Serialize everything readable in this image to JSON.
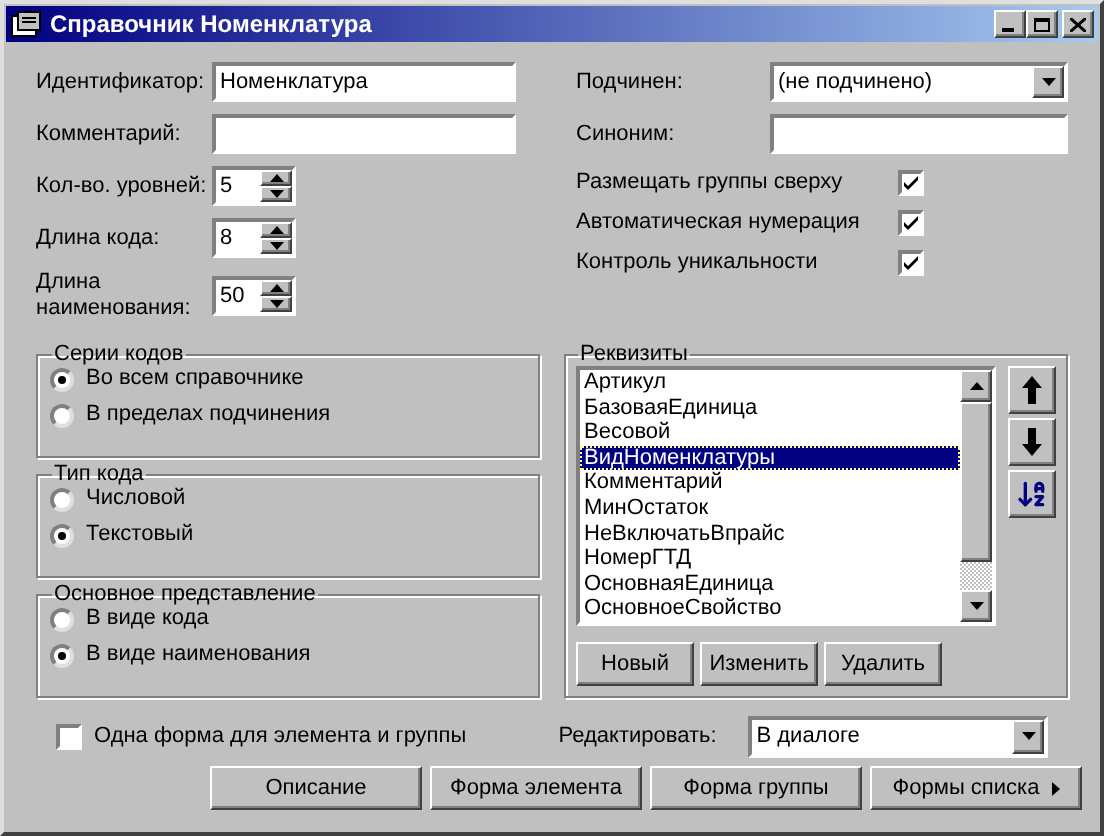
{
  "window": {
    "title": "Справочник Номенклатура"
  },
  "left_fields": [
    {
      "kind": "text",
      "label": "Идентификатор:",
      "value": "Номенклатура"
    },
    {
      "kind": "text",
      "label": "Комментарий:"
    },
    {
      "kind": "spin",
      "label": "Кол-во. уровней:",
      "value": "5"
    },
    {
      "kind": "spin",
      "label": "Длина кода:",
      "value": "8"
    },
    {
      "kind": "spin",
      "label": "Длина наименования:",
      "value": "50"
    }
  ],
  "right_fields": [
    {
      "kind": "select",
      "label": "Подчинен:",
      "value": "(не подчинено)"
    },
    {
      "kind": "text",
      "label": "Синоним:"
    }
  ],
  "options": [
    {
      "label": "Размещать группы сверху",
      "checked": true
    },
    {
      "label": "Автоматическая нумерация",
      "checked": true
    },
    {
      "label": "Контроль уникальности",
      "checked": true
    }
  ],
  "radio_groups": [
    {
      "title": "Серии кодов",
      "items": [
        {
          "label": "Во всем справочнике",
          "selected": true
        },
        {
          "label": "В пределах подчинения",
          "selected": false
        }
      ]
    },
    {
      "title": "Тип кода",
      "items": [
        {
          "label": "Числовой",
          "selected": false
        },
        {
          "label": "Текстовый",
          "selected": true
        }
      ]
    },
    {
      "title": "Основное представление",
      "items": [
        {
          "label": "В виде кода",
          "selected": false
        },
        {
          "label": "В виде наименования",
          "selected": true
        }
      ]
    }
  ],
  "attributes": {
    "title": "Реквизиты",
    "items": [
      {
        "label": "Артикул",
        "selected": false
      },
      {
        "label": "БазоваяЕдиница",
        "selected": false
      },
      {
        "label": "Весовой",
        "selected": false
      },
      {
        "label": "ВидНоменклатуры",
        "selected": true
      },
      {
        "label": "Комментарий",
        "selected": false
      },
      {
        "label": "МинОстаток",
        "selected": false
      },
      {
        "label": "НеВключатьВпрайс",
        "selected": false
      },
      {
        "label": "НомерГТД",
        "selected": false
      },
      {
        "label": "ОсновнаяЕдиница",
        "selected": false
      },
      {
        "label": "ОсновноеСвойство",
        "selected": false
      }
    ],
    "buttons": [
      "Новый",
      "Изменить",
      "Удалить"
    ]
  },
  "single_form": {
    "label": "Одна форма для элемента и группы",
    "checked": false
  },
  "edit_mode": {
    "label": "Редактировать:",
    "value": "В диалоге"
  },
  "buttons": [
    {
      "label": "Описание",
      "kind": "plain"
    },
    {
      "label": "Форма элемента",
      "kind": "plain"
    },
    {
      "label": "Форма группы",
      "kind": "plain"
    },
    {
      "label": "Формы списка",
      "kind": "menu"
    }
  ]
}
